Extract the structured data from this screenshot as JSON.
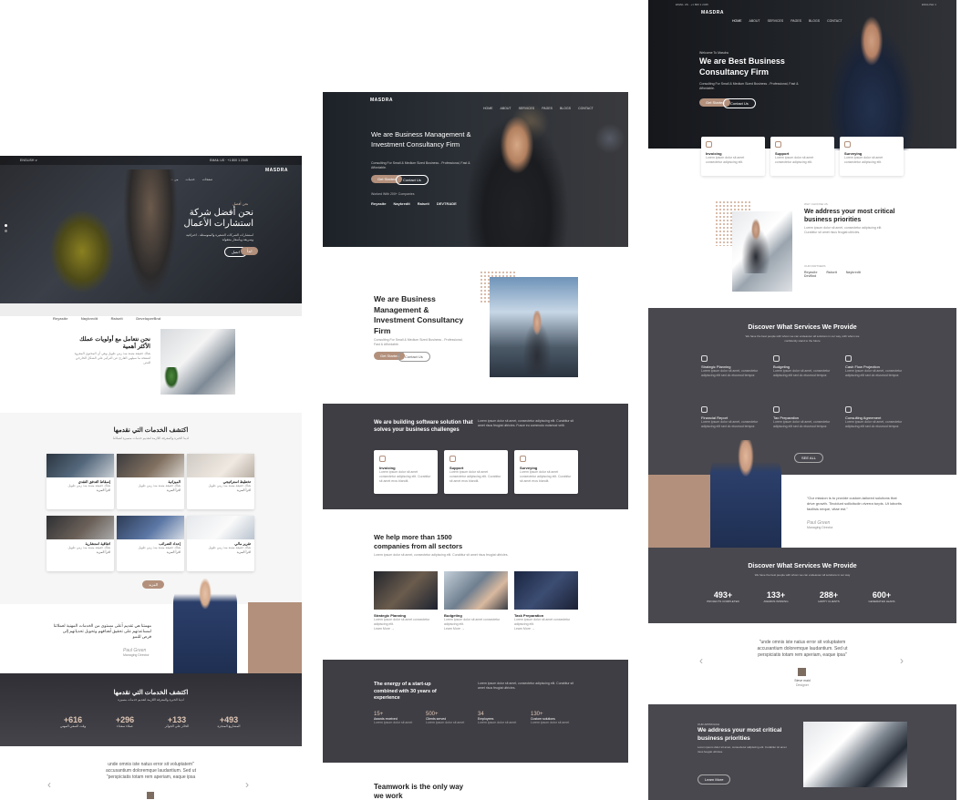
{
  "left": {
    "header": {
      "lang": "ENGLISH ∨",
      "logo": "MASDRA",
      "contact": "EMAIL US  ·  +1 800 1 2345"
    },
    "hero": {
      "kicker": "نحن أفضل",
      "title": "نحن أفضل شركة استشارات الأعمال",
      "subtitle": "استشارات الشركات الصغيرة والمتوسطة - احترافية وسريعة وبأسعار معقولة",
      "btn1": "ابدأ",
      "btn2": "اتصل"
    },
    "partners": [
      "Reyasite",
      "Naykredit",
      "Raiseit",
      "DeveloperBnd"
    ],
    "priorities": {
      "title": "نحن نتعامل مع أولويات عملك الأكثر أهمية",
      "body": "هناك حقيقة مثبتة منذ زمن طويل وهي أن المحتوى المقروء لصفحة ما سيلهي القارئ عن التركيز على الشكل الخارجي للنص"
    },
    "services": {
      "title": "اكتشف الخدمات التي نقدمها",
      "sub": "لدينا الخبرة والمعرفة اللازمة لتقديم خدمات متميزة لعملائنا",
      "cards": [
        {
          "label": "تخطيط استراتيجي",
          "more": "اقرأ المزيد"
        },
        {
          "label": "الميزانية",
          "more": "اقرأ المزيد"
        },
        {
          "label": "إسقاط التدفق النقدي",
          "more": "اقرأ المزيد"
        },
        {
          "label": "تقرير مالي",
          "more": "اقرأ المزيد"
        },
        {
          "label": "إعداد الضرائب",
          "more": "اقرأ المزيد"
        },
        {
          "label": "اتفاقية استشارية",
          "more": "اقرأ المزيد"
        }
      ],
      "btn": "المزيد"
    },
    "quote": {
      "text": "مهمتنا هي تقديم أعلى مستوى من الخدمات المهنية لعملائنا لمساعدتهم على تحقيق أهدافهم وتحويل تحدياتهم إلى فرص للنمو",
      "author": "Paul Green",
      "role": "Managing Director"
    },
    "stats": {
      "title": "اكتشف الخدمات التي نقدمها",
      "sub": "لدينا الخبرة والمعرفة اللازمة لتقديم خدمات متميزة",
      "items": [
        {
          "num": "+616",
          "label": "وقت السعي المهني"
        },
        {
          "num": "+296",
          "label": "عملاء سعداء"
        },
        {
          "num": "+133",
          "label": "الحائز على الجوائز"
        },
        {
          "num": "+493",
          "label": "المشاريع المنجزة"
        }
      ]
    },
    "testimonial": {
      "line1": "unde omnis iste natus error sit voluptatem\"",
      "line2": "accusantium doloremque laudantium. Sed ut",
      "line3": "\"perspiciatis totam rem aperiam, eaque ipsa"
    }
  },
  "middle": {
    "header": {
      "logo": "MASDRA",
      "nav": [
        "HOME",
        "ABOUT",
        "SERVICES",
        "PAGES",
        "BLOGS",
        "CONTACT"
      ]
    },
    "hero": {
      "title": "We are Business Management & Investment Consultancy Firm",
      "subtitle": "Consulting For Small & Medium Sized Business - Professional, Fast & Affordable.",
      "btn1": "Get Started",
      "btn2": "Contact Us",
      "trusted": "Worked With 200+ Companies",
      "partners": [
        "Reyasite",
        "Naykredit",
        "Raiseit",
        "DEVTRADE"
      ]
    },
    "about": {
      "title": "We are Business Management & Investment Consultancy Firm",
      "subtitle": "Consulting For Small & Medium Sized Business - Professional, Fast & Affordable.",
      "btn1": "Get Started",
      "btn2": "Contact Us"
    },
    "software": {
      "title": "We are building software solution that solves your business challenges",
      "body": "Lorem ipsum dolor sit amet, consectetur adipiscing elit. Curabitur sit amet risus feugiat ultricies. Fusce eu commodo euismod velit.",
      "cards": [
        {
          "label": "Invoicing",
          "text": "Lorem ipsum dolor sit amet consectetur adipiscing elit. Curabitur sit amet eros blandit."
        },
        {
          "label": "Support",
          "text": "Lorem ipsum dolor sit amet consectetur adipiscing elit. Curabitur sit amet eros blandit."
        },
        {
          "label": "Surveying",
          "text": "Lorem ipsum dolor sit amet consectetur adipiscing elit. Curabitur sit amet eros blandit."
        }
      ]
    },
    "help": {
      "title": "We help more than 1500 companies from all sectors",
      "body": "Lorem ipsum dolor sit amet, consectetur adipiscing elit. Curabitur sit amet risus feugiat ultricies.",
      "cards": [
        {
          "label": "Strategic Planning",
          "more": "Learn More →"
        },
        {
          "label": "Budgeting",
          "more": "Learn More →"
        },
        {
          "label": "Task Preparation",
          "more": "Learn More →"
        }
      ]
    },
    "energy": {
      "title": "The energy of a start-up combined with 30 years of experience",
      "body": "Lorem ipsum dolor sit amet, consectetur adipiscing elit. Curabitur sit amet risus feugiat ultricies.",
      "stats": [
        {
          "num": "15+",
          "label": "Awards received"
        },
        {
          "num": "500+",
          "label": "Clients served"
        },
        {
          "num": "34",
          "label": "Employees"
        },
        {
          "num": "130+",
          "label": "Custom solutions"
        }
      ]
    },
    "teamwork": {
      "title": "Teamwork is the only way we work"
    }
  },
  "right": {
    "header": {
      "logo": "MASDRA",
      "contact": "EMAIL US  ·  +1 800 1 2345",
      "lang": "ENGLISH ∨",
      "nav": [
        "HOME",
        "ABOUT",
        "SERVICES",
        "PAGES",
        "BLOGS",
        "CONTACT"
      ]
    },
    "hero": {
      "kicker": "Welcome To Masdra",
      "title": "We are Best Business Consultancy Firm",
      "subtitle": "Consulting For Small & Medium Sized Business - Professional, Fast & Affordable.",
      "btn1": "Get Started",
      "btn2": "Contact Us"
    },
    "features": [
      {
        "label": "Invoicing",
        "text": "Lorem ipsum dolor sit amet consectetur adipiscing elit."
      },
      {
        "label": "Support",
        "text": "Lorem ipsum dolor sit amet consectetur adipiscing elit."
      },
      {
        "label": "Surveying",
        "text": "Lorem ipsum dolor sit amet consectetur adipiscing elit."
      }
    ],
    "priorities": {
      "kicker": "WHY CHOOSE US",
      "title": "We address your most critical business priorities",
      "body": "Lorem ipsum dolor sit amet, consectetur adipiscing elit. Curabitur sit amet risus feugiat ultricies.",
      "partners_label": "OUR PARTNERS",
      "partners": [
        "Reyasite",
        "Raiseit",
        "Naykredit",
        "DevBnd"
      ]
    },
    "services": {
      "title": "Discover What Services We Provide",
      "sub": "We have the best people with whom we can endeavour all solutions in our way, with whom we confidently stand to the future",
      "items": [
        {
          "label": "Strategic Planning"
        },
        {
          "label": "Budgeting"
        },
        {
          "label": "Cash Flow Projection"
        },
        {
          "label": "Financial Report"
        },
        {
          "label": "Tax Preparation"
        },
        {
          "label": "Consulting Agreement"
        }
      ],
      "btn": "SEE ALL"
    },
    "quote": {
      "text": "\"Our mission is to provide custom-tailored solutions that drive growth. Tincidunt sollicitudin viverra turpis. Ut lobortis facilisis neque, vitae est.\"",
      "author": "Paul Green",
      "role": "Managing Director"
    },
    "stats": {
      "title": "Discover What Services We Provide",
      "sub": "We have the best people with whom we can endeavour all solutions in our way",
      "items": [
        {
          "num": "493+",
          "label": "PROJECTS COMPLETED"
        },
        {
          "num": "133+",
          "label": "AWARDS WINNING"
        },
        {
          "num": "288+",
          "label": "HAPPY CLIENTS"
        },
        {
          "num": "600+",
          "label": "GENERATED LEADS"
        }
      ]
    },
    "testimonial": {
      "line1": "\"unde omnis iste natus error sit voluptatem",
      "line2": "accusantium doloremque laudantium. Sed ut",
      "line3": "perspiciatis totam rem aperiam, eaque ipsa\"",
      "author": "Steve maid",
      "role": "Designer"
    },
    "bottom": {
      "kicker": "OUR APPROACH",
      "title": "We address your most critical business priorities",
      "body": "Lorem ipsum dolor sit amet, consectetur adipiscing elit. Curabitur sit amet risus feugiat ultricies.",
      "btn": "Learn More"
    }
  }
}
